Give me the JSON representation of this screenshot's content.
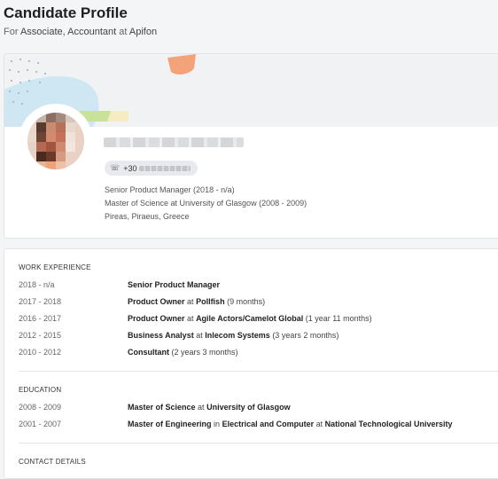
{
  "header": {
    "title": "Candidate Profile",
    "subtitle_for": "For",
    "position": "Associate, Accountant",
    "subtitle_at": "at",
    "company": "Apifon"
  },
  "profile": {
    "phone_prefix": "+30",
    "summary": [
      "Senior Product Manager (2018 - n/a)",
      "Master of Science at University of Glasgow (2008 - 2009)",
      "Pireas, Piraeus, Greece"
    ]
  },
  "work_experience": {
    "heading": "WORK EXPERIENCE",
    "items": [
      {
        "period": "2018 - n/a",
        "title": "Senior Product Manager",
        "at": "",
        "company": "",
        "duration": ""
      },
      {
        "period": "2017 - 2018",
        "title": "Product Owner",
        "at": "at",
        "company": "Pollfish",
        "duration": "(9 months)"
      },
      {
        "period": "2016 - 2017",
        "title": "Product Owner",
        "at": "at",
        "company": "Agile Actors/Camelot Global",
        "duration": "(1 year 11 months)"
      },
      {
        "period": "2012 - 2015",
        "title": "Business Analyst",
        "at": "at",
        "company": "Inlecom Systems",
        "duration": "(3 years 2 months)"
      },
      {
        "period": "2010 - 2012",
        "title": "Consultant",
        "at": "",
        "company": "",
        "duration": "(2 years 3 months)"
      }
    ]
  },
  "education": {
    "heading": "EDUCATION",
    "items": [
      {
        "period": "2008 - 2009",
        "degree": "Master of Science",
        "in": "",
        "field": "",
        "at": "at",
        "school": "University of Glasgow"
      },
      {
        "period": "2001 - 2007",
        "degree": "Master of Engineering",
        "in": "in",
        "field": "Electrical and Computer",
        "at": "at",
        "school": "National Technological University"
      }
    ]
  },
  "contact": {
    "heading": "CONTACT DETAILS"
  },
  "colors": {
    "banner_bg": "#f1f2f3",
    "blue_shape": "#cfe6f3",
    "orange_shape": "#f4a27a",
    "green_shape": "#c8e29a",
    "yellow_shape": "#f6ecc4"
  },
  "icons": {
    "phone": "phone-icon"
  }
}
